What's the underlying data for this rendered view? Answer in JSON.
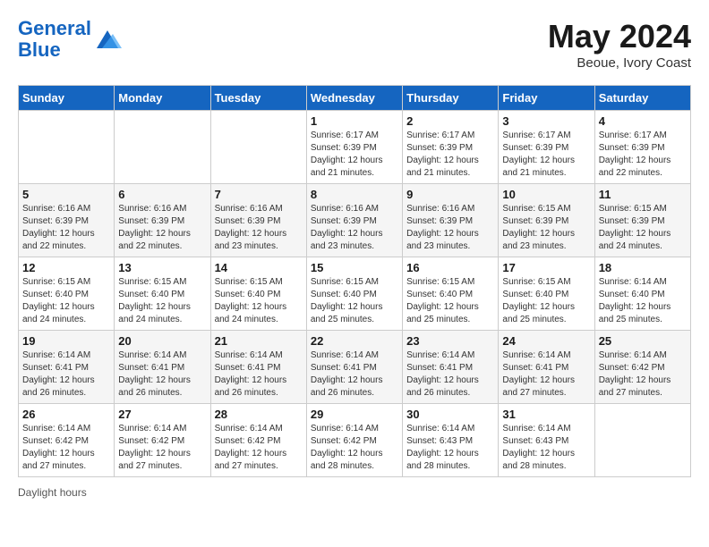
{
  "header": {
    "logo_line1": "General",
    "logo_line2": "Blue",
    "month": "May 2024",
    "location": "Beoue, Ivory Coast"
  },
  "days_of_week": [
    "Sunday",
    "Monday",
    "Tuesday",
    "Wednesday",
    "Thursday",
    "Friday",
    "Saturday"
  ],
  "weeks": [
    [
      {
        "day": "",
        "sunrise": "",
        "sunset": "",
        "daylight": ""
      },
      {
        "day": "",
        "sunrise": "",
        "sunset": "",
        "daylight": ""
      },
      {
        "day": "",
        "sunrise": "",
        "sunset": "",
        "daylight": ""
      },
      {
        "day": "1",
        "sunrise": "Sunrise: 6:17 AM",
        "sunset": "Sunset: 6:39 PM",
        "daylight": "Daylight: 12 hours and 21 minutes."
      },
      {
        "day": "2",
        "sunrise": "Sunrise: 6:17 AM",
        "sunset": "Sunset: 6:39 PM",
        "daylight": "Daylight: 12 hours and 21 minutes."
      },
      {
        "day": "3",
        "sunrise": "Sunrise: 6:17 AM",
        "sunset": "Sunset: 6:39 PM",
        "daylight": "Daylight: 12 hours and 21 minutes."
      },
      {
        "day": "4",
        "sunrise": "Sunrise: 6:17 AM",
        "sunset": "Sunset: 6:39 PM",
        "daylight": "Daylight: 12 hours and 22 minutes."
      }
    ],
    [
      {
        "day": "5",
        "sunrise": "Sunrise: 6:16 AM",
        "sunset": "Sunset: 6:39 PM",
        "daylight": "Daylight: 12 hours and 22 minutes."
      },
      {
        "day": "6",
        "sunrise": "Sunrise: 6:16 AM",
        "sunset": "Sunset: 6:39 PM",
        "daylight": "Daylight: 12 hours and 22 minutes."
      },
      {
        "day": "7",
        "sunrise": "Sunrise: 6:16 AM",
        "sunset": "Sunset: 6:39 PM",
        "daylight": "Daylight: 12 hours and 23 minutes."
      },
      {
        "day": "8",
        "sunrise": "Sunrise: 6:16 AM",
        "sunset": "Sunset: 6:39 PM",
        "daylight": "Daylight: 12 hours and 23 minutes."
      },
      {
        "day": "9",
        "sunrise": "Sunrise: 6:16 AM",
        "sunset": "Sunset: 6:39 PM",
        "daylight": "Daylight: 12 hours and 23 minutes."
      },
      {
        "day": "10",
        "sunrise": "Sunrise: 6:15 AM",
        "sunset": "Sunset: 6:39 PM",
        "daylight": "Daylight: 12 hours and 23 minutes."
      },
      {
        "day": "11",
        "sunrise": "Sunrise: 6:15 AM",
        "sunset": "Sunset: 6:39 PM",
        "daylight": "Daylight: 12 hours and 24 minutes."
      }
    ],
    [
      {
        "day": "12",
        "sunrise": "Sunrise: 6:15 AM",
        "sunset": "Sunset: 6:40 PM",
        "daylight": "Daylight: 12 hours and 24 minutes."
      },
      {
        "day": "13",
        "sunrise": "Sunrise: 6:15 AM",
        "sunset": "Sunset: 6:40 PM",
        "daylight": "Daylight: 12 hours and 24 minutes."
      },
      {
        "day": "14",
        "sunrise": "Sunrise: 6:15 AM",
        "sunset": "Sunset: 6:40 PM",
        "daylight": "Daylight: 12 hours and 24 minutes."
      },
      {
        "day": "15",
        "sunrise": "Sunrise: 6:15 AM",
        "sunset": "Sunset: 6:40 PM",
        "daylight": "Daylight: 12 hours and 25 minutes."
      },
      {
        "day": "16",
        "sunrise": "Sunrise: 6:15 AM",
        "sunset": "Sunset: 6:40 PM",
        "daylight": "Daylight: 12 hours and 25 minutes."
      },
      {
        "day": "17",
        "sunrise": "Sunrise: 6:15 AM",
        "sunset": "Sunset: 6:40 PM",
        "daylight": "Daylight: 12 hours and 25 minutes."
      },
      {
        "day": "18",
        "sunrise": "Sunrise: 6:14 AM",
        "sunset": "Sunset: 6:40 PM",
        "daylight": "Daylight: 12 hours and 25 minutes."
      }
    ],
    [
      {
        "day": "19",
        "sunrise": "Sunrise: 6:14 AM",
        "sunset": "Sunset: 6:41 PM",
        "daylight": "Daylight: 12 hours and 26 minutes."
      },
      {
        "day": "20",
        "sunrise": "Sunrise: 6:14 AM",
        "sunset": "Sunset: 6:41 PM",
        "daylight": "Daylight: 12 hours and 26 minutes."
      },
      {
        "day": "21",
        "sunrise": "Sunrise: 6:14 AM",
        "sunset": "Sunset: 6:41 PM",
        "daylight": "Daylight: 12 hours and 26 minutes."
      },
      {
        "day": "22",
        "sunrise": "Sunrise: 6:14 AM",
        "sunset": "Sunset: 6:41 PM",
        "daylight": "Daylight: 12 hours and 26 minutes."
      },
      {
        "day": "23",
        "sunrise": "Sunrise: 6:14 AM",
        "sunset": "Sunset: 6:41 PM",
        "daylight": "Daylight: 12 hours and 26 minutes."
      },
      {
        "day": "24",
        "sunrise": "Sunrise: 6:14 AM",
        "sunset": "Sunset: 6:41 PM",
        "daylight": "Daylight: 12 hours and 27 minutes."
      },
      {
        "day": "25",
        "sunrise": "Sunrise: 6:14 AM",
        "sunset": "Sunset: 6:42 PM",
        "daylight": "Daylight: 12 hours and 27 minutes."
      }
    ],
    [
      {
        "day": "26",
        "sunrise": "Sunrise: 6:14 AM",
        "sunset": "Sunset: 6:42 PM",
        "daylight": "Daylight: 12 hours and 27 minutes."
      },
      {
        "day": "27",
        "sunrise": "Sunrise: 6:14 AM",
        "sunset": "Sunset: 6:42 PM",
        "daylight": "Daylight: 12 hours and 27 minutes."
      },
      {
        "day": "28",
        "sunrise": "Sunrise: 6:14 AM",
        "sunset": "Sunset: 6:42 PM",
        "daylight": "Daylight: 12 hours and 27 minutes."
      },
      {
        "day": "29",
        "sunrise": "Sunrise: 6:14 AM",
        "sunset": "Sunset: 6:42 PM",
        "daylight": "Daylight: 12 hours and 28 minutes."
      },
      {
        "day": "30",
        "sunrise": "Sunrise: 6:14 AM",
        "sunset": "Sunset: 6:43 PM",
        "daylight": "Daylight: 12 hours and 28 minutes."
      },
      {
        "day": "31",
        "sunrise": "Sunrise: 6:14 AM",
        "sunset": "Sunset: 6:43 PM",
        "daylight": "Daylight: 12 hours and 28 minutes."
      },
      {
        "day": "",
        "sunrise": "",
        "sunset": "",
        "daylight": ""
      }
    ]
  ],
  "footer": {
    "daylight_label": "Daylight hours"
  }
}
